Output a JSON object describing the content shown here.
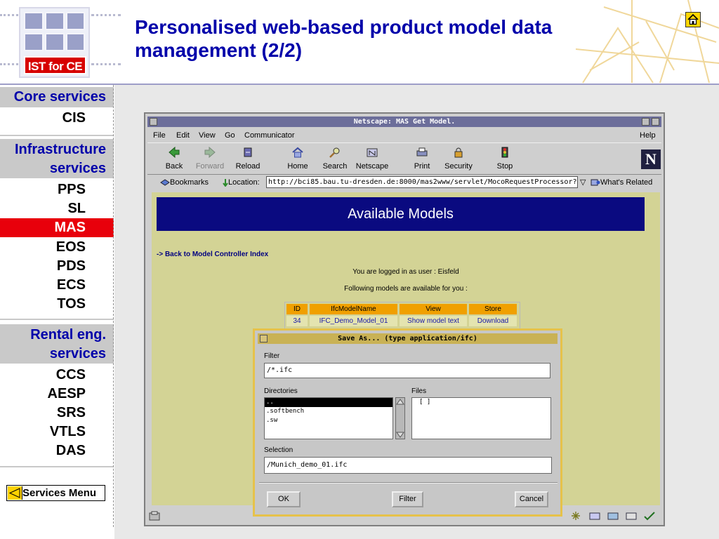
{
  "slide": {
    "title": "Personalised web-based product model data management (2/2)",
    "logo_text": "IST for CE",
    "home_icon": "home-icon"
  },
  "nav": {
    "sections": [
      {
        "heading": "Core services",
        "items": [
          "CIS"
        ]
      },
      {
        "heading": "Infrastructure services",
        "items": [
          "PPS",
          "SL",
          "MAS",
          "EOS",
          "PDS",
          "ECS",
          "TOS"
        ]
      },
      {
        "heading": "Rental eng. services",
        "items": [
          "CCS",
          "AESP",
          "SRS",
          "VTLS",
          "DAS"
        ]
      }
    ],
    "active_item": "MAS",
    "services_menu": "Services Menu"
  },
  "browser": {
    "window_title": "Netscape: MAS Get Model.",
    "menu": [
      "File",
      "Edit",
      "View",
      "Go",
      "Communicator",
      "Help"
    ],
    "toolbar": [
      "Back",
      "Forward",
      "Reload",
      "Home",
      "Search",
      "Netscape",
      "Print",
      "Security",
      "Stop"
    ],
    "bookmarks_label": "Bookmarks",
    "location_label": "Location:",
    "url": "http://bci85.bau.tu-dresden.de:8000/mas2www/servlet/MocoRequestProcessor?",
    "whats_related": "What's Related",
    "page": {
      "banner": "Available Models",
      "back_link": "-> Back to Model Controller Index",
      "logged_in": "You are logged in as user : Eisfeld",
      "available": "Following models are available for you :",
      "table": {
        "headers": [
          "ID",
          "IfcModelName",
          "View",
          "Store"
        ],
        "row": [
          "34",
          "IFC_Demo_Model_01",
          "Show model text",
          "Download"
        ]
      }
    }
  },
  "dialog": {
    "title": "Save As... (type application/ifc)",
    "filter_label": "Filter",
    "filter_value": "/*.ifc",
    "directories_label": "Directories",
    "directories": [
      "..",
      ".softbench",
      ".sw"
    ],
    "files_label": "Files",
    "files": [
      "[      ]"
    ],
    "selection_label": "Selection",
    "selection_value": "/Munich_demo_01.ifc",
    "buttons": [
      "OK",
      "Filter",
      "Cancel"
    ]
  },
  "colors": {
    "title_blue": "#0000aa",
    "active_red": "#e8000b",
    "nav_grey": "#c9c9c9",
    "page_bg": "#d3d395",
    "banner_navy": "#0a0a80",
    "table_header_orange": "#f0a000"
  }
}
